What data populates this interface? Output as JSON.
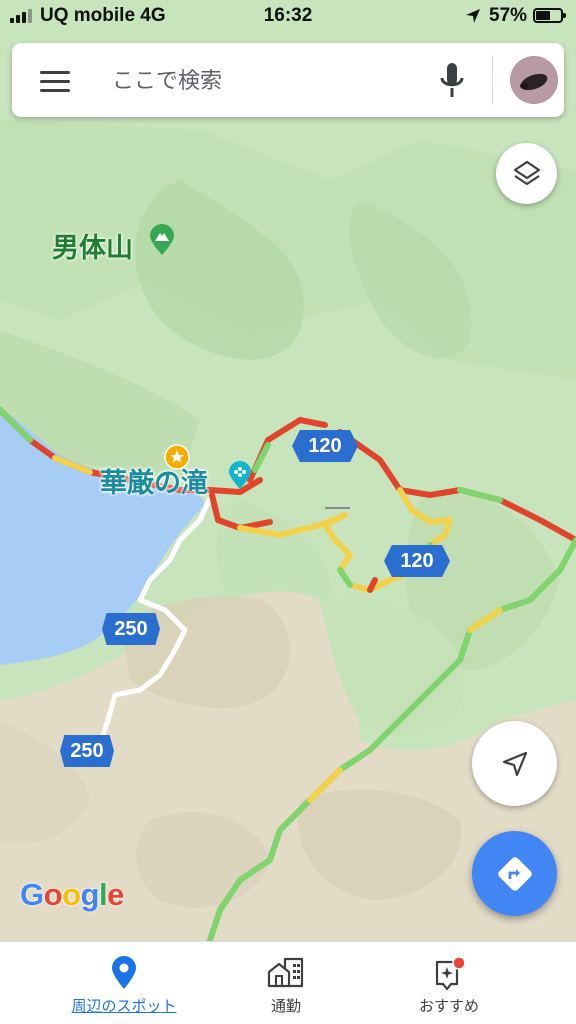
{
  "status_bar": {
    "carrier": "UQ mobile 4G",
    "time": "16:32",
    "battery_text": "57%",
    "battery_level": 0.57
  },
  "search": {
    "placeholder": "ここで検索"
  },
  "map": {
    "labels": {
      "mountain": "男体山",
      "waterfall": "華厳の滝"
    },
    "road_shields": [
      "120",
      "120",
      "250",
      "250"
    ],
    "attribution": "Google",
    "colors": {
      "water": "#a7cdf6",
      "forest": "#c4e2b9",
      "terrain": "#e4dcc9",
      "traffic_fast": "#7fd46d",
      "traffic_medium": "#f3d24b",
      "traffic_slow": "#e0452c",
      "road_shield": "#2a6fd0",
      "accent": "#4285f4"
    }
  },
  "buttons": {
    "layers_icon": "layers-icon",
    "locate_icon": "navigation-arrow-icon",
    "directions_icon": "directions-icon"
  },
  "bottom_nav": {
    "items": [
      {
        "label": "周辺のスポット",
        "icon": "location-pin-icon",
        "active": true
      },
      {
        "label": "通勤",
        "icon": "buildings-icon",
        "active": false
      },
      {
        "label": "おすすめ",
        "icon": "sparkle-card-icon",
        "active": false,
        "badge": true
      }
    ]
  }
}
